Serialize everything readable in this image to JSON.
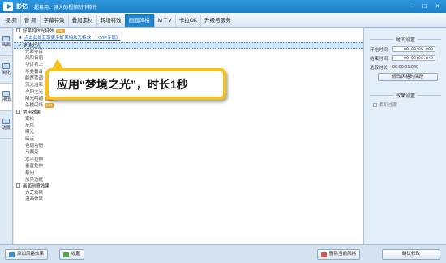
{
  "titlebar": {
    "app_name": "影忆",
    "slogan": "超易用、强大的视频制作软件"
  },
  "menu": {
    "tabs": [
      {
        "label": "视 频"
      },
      {
        "label": "音 频"
      },
      {
        "label": "字幕特效"
      },
      {
        "label": "叠加素材"
      },
      {
        "label": "转场特效"
      },
      {
        "label": "画面风格",
        "active": true
      },
      {
        "label": "M T V"
      },
      {
        "label": "卡拉OK"
      },
      {
        "label": "升级与服务"
      }
    ]
  },
  "side_tabs": [
    {
      "label": "画面"
    },
    {
      "label": "美化"
    },
    {
      "label": "滤镜",
      "active": true
    },
    {
      "label": "动景"
    }
  ],
  "list": {
    "group1": "好莱坞炫光特效",
    "link": "点击此处获取更多好莱坞炫光特效！（VIP专属）",
    "selected": "梦境之光",
    "items_a": [
      "光彩夺目",
      "风和日丽",
      "华灯初上",
      "华美舞台",
      "翩然蓝调",
      "流光溢彩",
      "夕阳之光",
      "阳光明媚",
      "杀楼闪烁"
    ],
    "group2": "常用效果",
    "items_b": [
      "宽松",
      "反色",
      "曝光",
      "噪点",
      "色调均衡",
      "马赛克",
      "水平拉伸",
      "垂直拉伸",
      "暴闪",
      "加黑边框"
    ],
    "group3": "画面创意效果",
    "items_c": [
      "方芝效果",
      "漫画效果"
    ],
    "vip_label": "VIP"
  },
  "callout": {
    "text": "应用“梦境之光”，时长1秒"
  },
  "panel": {
    "time_title": "时间设置",
    "start_label": "开始时间:",
    "start_value": "00:00:05.800",
    "end_label": "结束时间:",
    "end_value": "00:00:06.840",
    "duration_label": "选取时长:",
    "duration_value": "00:00:01.040",
    "modify_button": "修改风格时间段",
    "effect_title": "效果设置",
    "soft_transition": "柔和过渡"
  },
  "bottom": {
    "add_button": "添加风格效果",
    "fav_button": "收起",
    "delete_button": "删除当前风格",
    "confirm_button": "确认修改"
  }
}
